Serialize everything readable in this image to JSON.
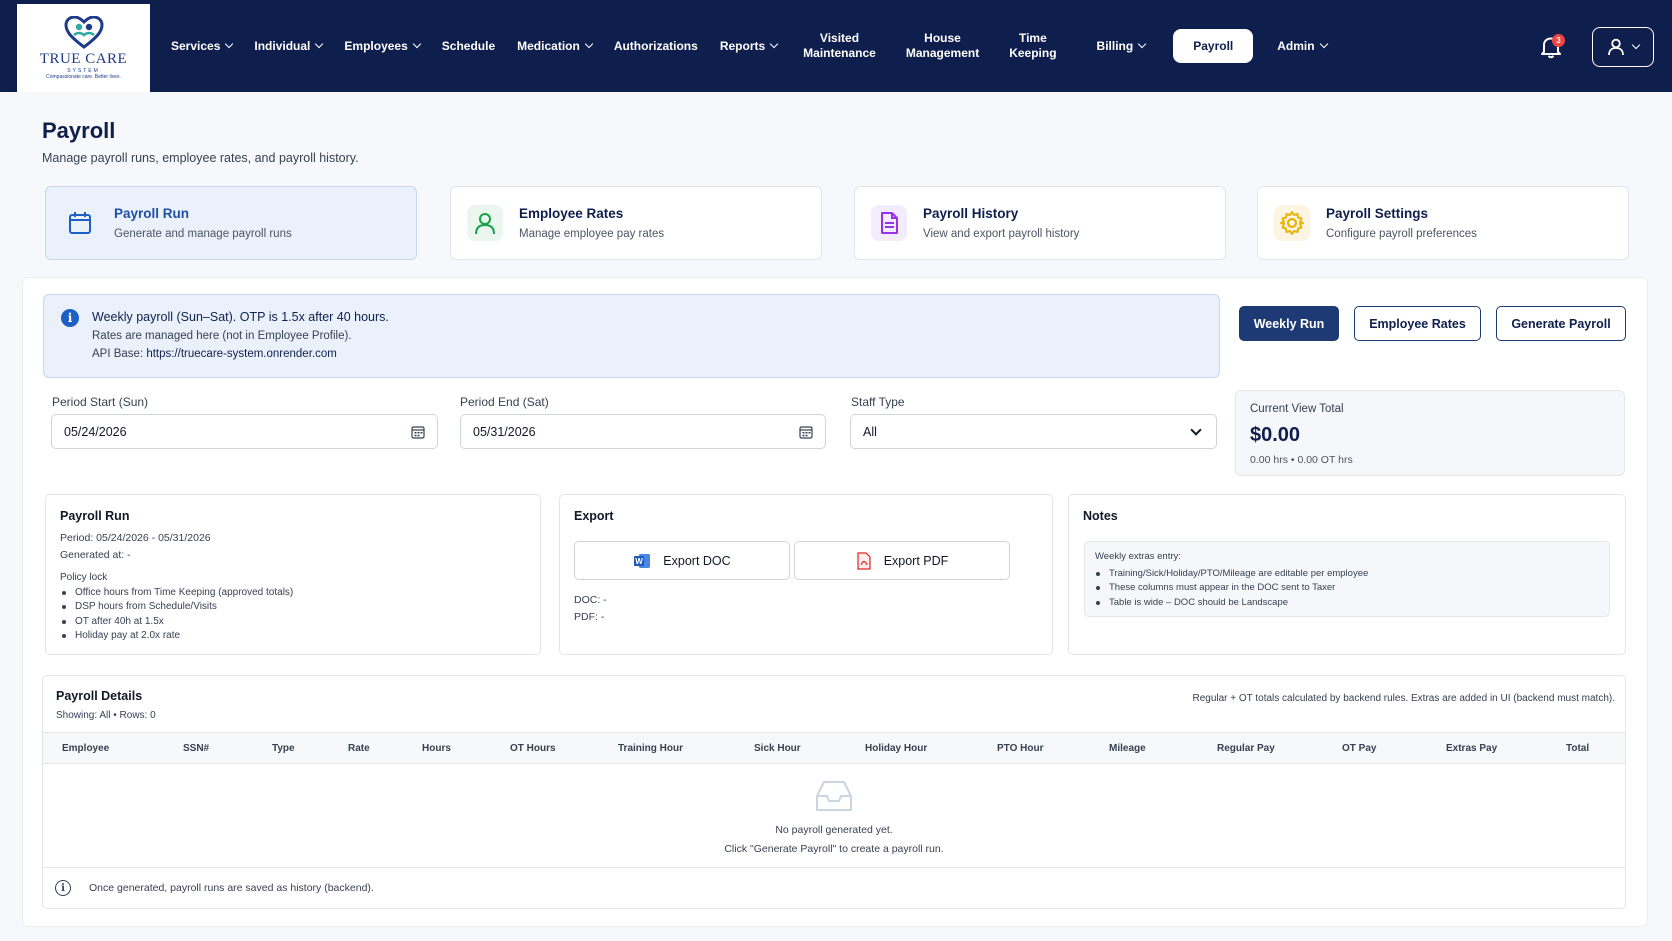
{
  "brand": {
    "name": "TRUE CARE",
    "sub1": "SYSTEM",
    "sub2": "Compassionate care. Better lives."
  },
  "nav": {
    "services": "Services",
    "individual": "Individual",
    "employees": "Employees",
    "schedule": "Schedule",
    "medication": "Medication",
    "authorizations": "Authorizations",
    "reports": "Reports",
    "visited_1": "Visited",
    "visited_2": "Maintenance",
    "house_1": "House",
    "house_2": "Management",
    "time_1": "Time",
    "time_2": "Keeping",
    "billing": "Billing",
    "payroll": "Payroll",
    "admin": "Admin",
    "notification_count": "3"
  },
  "header": {
    "title": "Payroll",
    "subtitle": "Manage payroll runs, employee rates, and payroll history."
  },
  "cards": [
    {
      "title": "Payroll Run",
      "desc": "Generate and manage payroll runs",
      "icon": "calendar-icon"
    },
    {
      "title": "Employee Rates",
      "desc": "Manage employee pay rates",
      "icon": "user-icon"
    },
    {
      "title": "Payroll History",
      "desc": "View and export payroll history",
      "icon": "document-icon"
    },
    {
      "title": "Payroll Settings",
      "desc": "Configure payroll preferences",
      "icon": "gear-icon"
    }
  ],
  "info": {
    "line1": "Weekly payroll (Sun–Sat). OTP is 1.5x after 40 hours.",
    "line2": "Rates are managed here (not in Employee Profile).",
    "line3_label": "API Base:",
    "line3_url": "https://truecare-system.onrender.com"
  },
  "actions": {
    "weekly_run": "Weekly Run",
    "employee_rates": "Employee Rates",
    "generate_payroll": "Generate Payroll"
  },
  "filters": {
    "period_start_label": "Period Start (Sun)",
    "period_start_value": "05/24/2026",
    "period_end_label": "Period End (Sat)",
    "period_end_value": "05/31/2026",
    "staff_type_label": "Staff Type",
    "staff_type_value": "All"
  },
  "total": {
    "label": "Current View Total",
    "value": "$0.00",
    "meta": "0.00 hrs • 0.00 OT hrs"
  },
  "payroll_run": {
    "title": "Payroll Run",
    "period": "Period: 05/24/2026 - 05/31/2026",
    "generated": "Generated at: -",
    "policy_title": "Policy lock",
    "policies": [
      "Office hours from Time Keeping (approved totals)",
      "DSP hours from Schedule/Visits",
      "OT after 40h at 1.5x",
      "Holiday pay at 2.0x rate"
    ]
  },
  "export": {
    "title": "Export",
    "doc_button": "Export DOC",
    "pdf_button": "Export PDF",
    "doc_status": "DOC: -",
    "pdf_status": "PDF: -"
  },
  "notes": {
    "title": "Notes",
    "heading": "Weekly extras entry:",
    "items": [
      "Training/Sick/Holiday/PTO/Mileage are editable per employee",
      "These columns must appear in the DOC sent to Taxer",
      "Table is wide – DOC should be Landscape"
    ]
  },
  "details": {
    "title": "Payroll Details",
    "showing": "Showing: All • Rows: 0",
    "note": "Regular + OT totals calculated by backend rules. Extras are added in UI (backend must match).",
    "columns": [
      "Employee",
      "SSN#",
      "Type",
      "Rate",
      "Hours",
      "OT Hours",
      "Training Hour",
      "Sick Hour",
      "Holiday Hour",
      "PTO Hour",
      "Mileage",
      "Regular Pay",
      "OT Pay",
      "Extras Pay",
      "Total"
    ],
    "empty_line1": "No payroll generated yet.",
    "empty_line2": "Click \"Generate Payroll\" to create a payroll run.",
    "footer": "Once generated, payroll runs are saved as history (backend)."
  },
  "colors": {
    "navy": "#0f1f4d",
    "primary": "#1e3a75",
    "info_bg": "#eaf1fb",
    "badge": "#ef4444"
  }
}
